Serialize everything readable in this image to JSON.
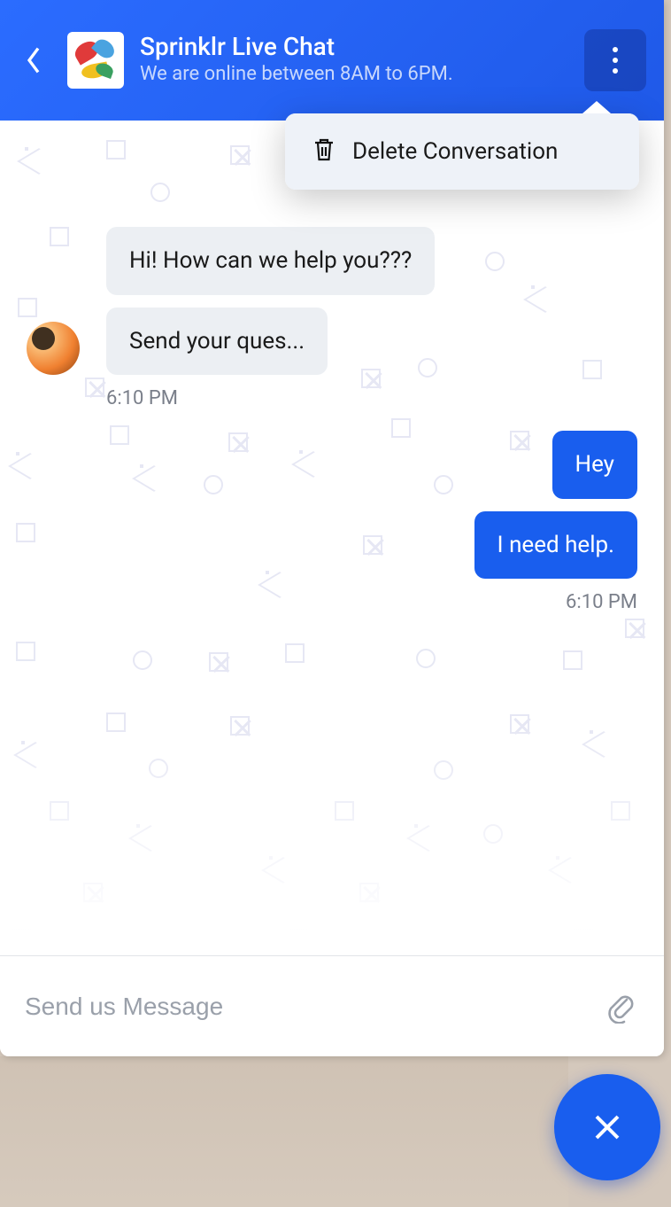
{
  "header": {
    "title": "Sprinklr Live Chat",
    "subtitle": "We are online between 8AM to 6PM."
  },
  "dropdown": {
    "delete_label": "Delete Conversation"
  },
  "messages": {
    "incoming": [
      {
        "text": "Hi! How can we help you???"
      },
      {
        "text": "Send your ques..."
      }
    ],
    "incoming_time": "6:10 PM",
    "outgoing": [
      {
        "text": "Hey"
      },
      {
        "text": "I need help."
      }
    ],
    "outgoing_time": "6:10 PM"
  },
  "input": {
    "placeholder": "Send us Message"
  }
}
